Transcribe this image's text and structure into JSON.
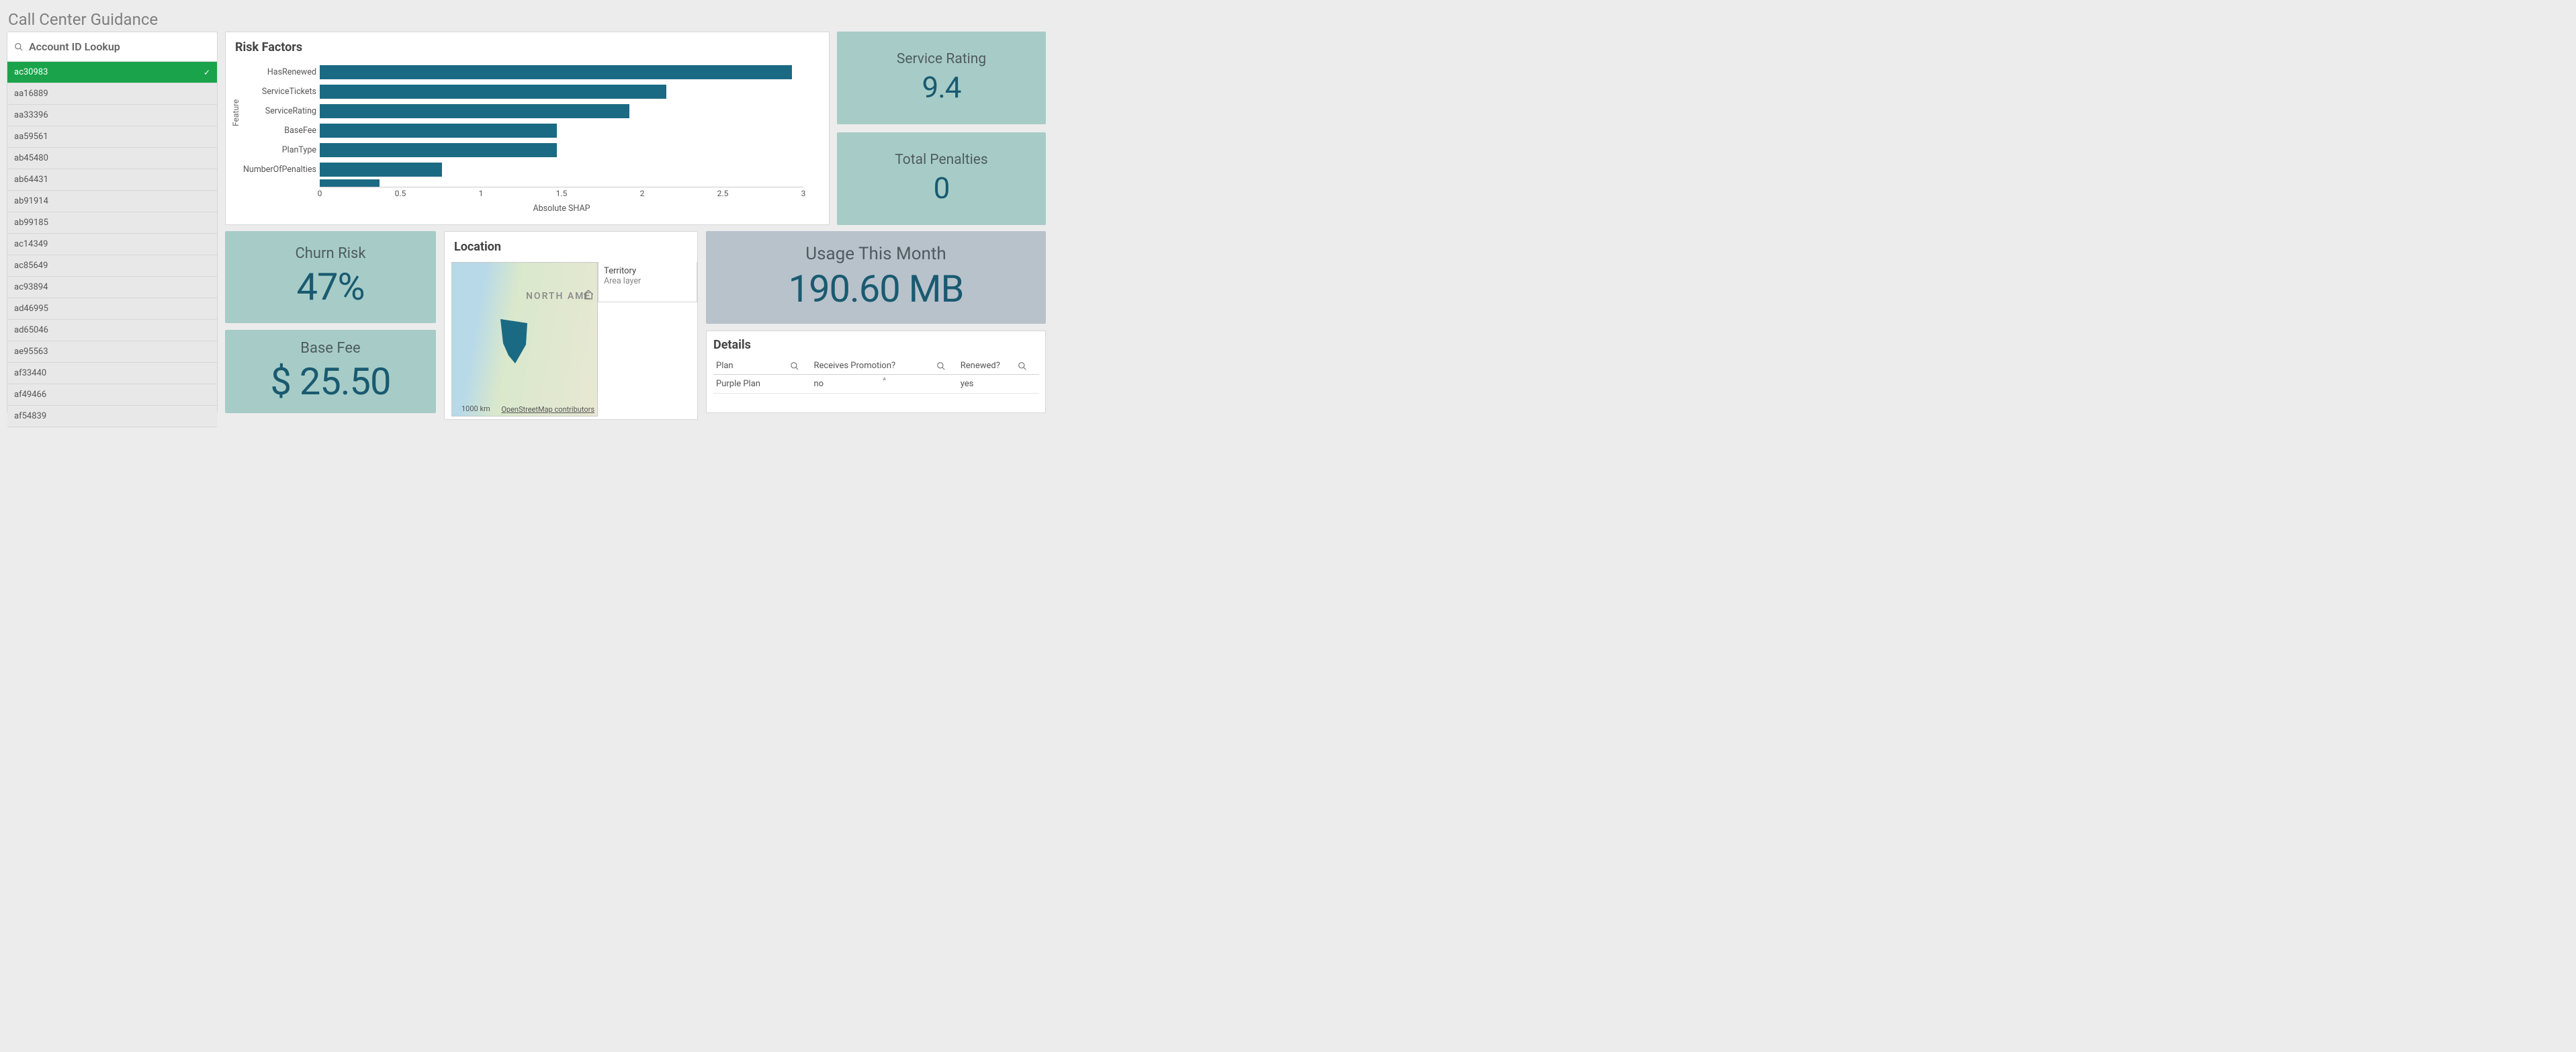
{
  "page_title": "Call Center Guidance",
  "search": {
    "label": "Account ID Lookup"
  },
  "accounts": {
    "selected": "ac30983",
    "items": [
      "ac30983",
      "aa16889",
      "aa33396",
      "aa59561",
      "ab45480",
      "ab64431",
      "ab91914",
      "ab99185",
      "ac14349",
      "ac85649",
      "ac93894",
      "ad46995",
      "ad65046",
      "ae95563",
      "af33440",
      "af49466",
      "af54839"
    ]
  },
  "risk_factors": {
    "title": "Risk Factors"
  },
  "kpis": {
    "service_rating": {
      "title": "Service Rating",
      "value": "9.4"
    },
    "total_penalties": {
      "title": "Total Penalties",
      "value": "0"
    },
    "churn_risk": {
      "title": "Churn Risk",
      "value": "47%"
    },
    "base_fee": {
      "title": "Base Fee",
      "value": "$ 25.50"
    },
    "usage": {
      "title": "Usage This Month",
      "value": "190.60 MB"
    }
  },
  "location": {
    "title": "Location",
    "legend_title": "Territory",
    "legend_sub": "Area layer",
    "scale": "1000 km",
    "attribution": "OpenStreetMap contributors",
    "label": "NORTH AME"
  },
  "details": {
    "title": "Details",
    "columns": [
      "Plan",
      "Receives Promotion?",
      "Renewed?"
    ],
    "row": [
      "Purple Plan",
      "no",
      "yes"
    ]
  },
  "chart_data": {
    "type": "bar",
    "orientation": "horizontal",
    "title": "Risk Factors",
    "xlabel": "Absolute SHAP",
    "ylabel": "Feature",
    "xlim": [
      0,
      3
    ],
    "xticks": [
      0,
      0.5,
      1,
      1.5,
      2,
      2.5,
      3
    ],
    "categories": [
      "HasRenewed",
      "ServiceTickets",
      "ServiceRating",
      "BaseFee",
      "PlanType",
      "NumberOfPenalties"
    ],
    "values": [
      2.93,
      2.15,
      1.92,
      1.47,
      1.47,
      0.76
    ],
    "partial_bar_value": 0.37
  }
}
